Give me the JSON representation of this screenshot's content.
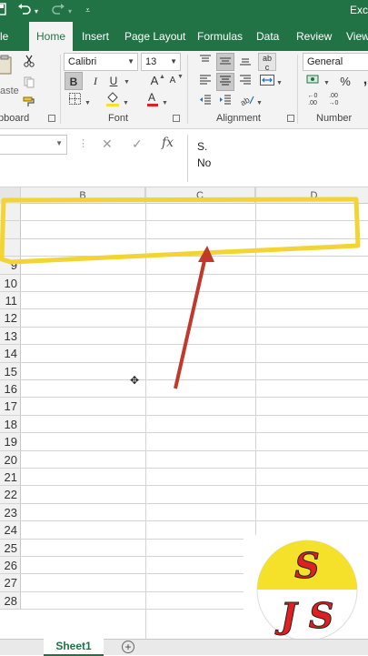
{
  "app": {
    "title_partial": "Exc",
    "quick_access": [
      "save-icon",
      "undo-icon",
      "redo-icon",
      "customize-icon"
    ]
  },
  "tabs": [
    {
      "label": "le"
    },
    {
      "label": "Home",
      "active": true
    },
    {
      "label": "Insert"
    },
    {
      "label": "Page Layout"
    },
    {
      "label": "Formulas"
    },
    {
      "label": "Data"
    },
    {
      "label": "Review"
    },
    {
      "label": "View"
    }
  ],
  "ribbon": {
    "clipboard": {
      "label": "pboard",
      "paste_label": "aste"
    },
    "font": {
      "label": "Font",
      "name": "Calibri",
      "size": "13",
      "bold": "B",
      "italic": "I",
      "underline": "U",
      "grow": "A",
      "shrink": "A"
    },
    "alignment": {
      "label": "Alignment",
      "wrap_label": "ab"
    },
    "number": {
      "label": "Number",
      "format": "General",
      "percent": "%",
      "comma": ",",
      "inc_decimal": ".00",
      "dec_decimal": ".00"
    }
  },
  "formula_bar": {
    "cancel": "✕",
    "enter": "✓",
    "fx": "fx",
    "content_line1": "S.",
    "content_line2": "No"
  },
  "grid": {
    "columns": [
      "B",
      "C",
      "D"
    ],
    "rows": [
      "",
      "",
      "",
      "9",
      "10",
      "11",
      "12",
      "13",
      "14",
      "15",
      "16",
      "17",
      "18",
      "19",
      "20",
      "21",
      "22",
      "23",
      "24",
      "25",
      "26",
      "27",
      "28"
    ],
    "highlight_color": "#f2d435",
    "arrow_color": "#c0392b"
  },
  "sheets": [
    {
      "label": "Sheet1",
      "active": true
    }
  ],
  "add_sheet": "+",
  "logo": {
    "top_letter": "S",
    "bottom_letters": "J S",
    "top_color": "#f5e02a",
    "letter_color": "#e02020"
  },
  "colors": {
    "excel_green": "#217346"
  }
}
